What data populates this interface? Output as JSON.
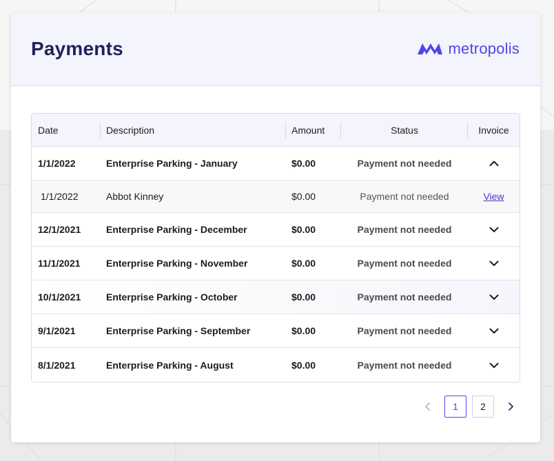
{
  "header": {
    "title": "Payments"
  },
  "brand": {
    "name": "metropolis",
    "color": "#4f46e5",
    "icon": "metropolis-logo-icon"
  },
  "table": {
    "columns": {
      "date": "Date",
      "description": "Description",
      "amount": "Amount",
      "status": "Status",
      "invoice": "Invoice"
    },
    "rows": [
      {
        "date": "1/1/2022",
        "description": "Enterprise Parking - January",
        "amount": "$0.00",
        "status": "Payment not needed",
        "expanded": true
      },
      {
        "date": "12/1/2021",
        "description": "Enterprise Parking - December",
        "amount": "$0.00",
        "status": "Payment not needed",
        "expanded": false
      },
      {
        "date": "11/1/2021",
        "description": "Enterprise Parking - November",
        "amount": "$0.00",
        "status": "Payment not needed",
        "expanded": false
      },
      {
        "date": "10/1/2021",
        "description": "Enterprise Parking - October",
        "amount": "$0.00",
        "status": "Payment not needed",
        "expanded": false
      },
      {
        "date": "9/1/2021",
        "description": "Enterprise Parking - September",
        "amount": "$0.00",
        "status": "Payment not needed",
        "expanded": false
      },
      {
        "date": "8/1/2021",
        "description": "Enterprise Parking - August",
        "amount": "$0.00",
        "status": "Payment not needed",
        "expanded": false
      }
    ],
    "sub_row": {
      "date": "1/1/2022",
      "description": "Abbot Kinney",
      "amount": "$0.00",
      "status": "Payment not needed",
      "invoice_link": "View"
    }
  },
  "pagination": {
    "pages": [
      "1",
      "2"
    ],
    "current": "1"
  }
}
